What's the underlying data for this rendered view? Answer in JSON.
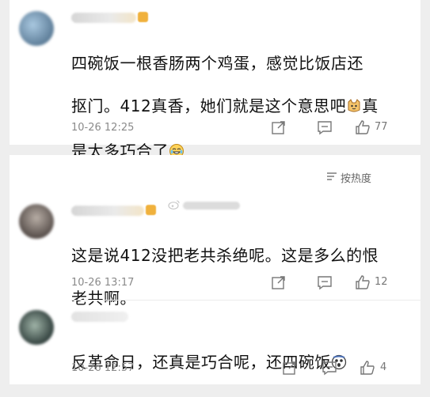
{
  "comments": [
    {
      "text_lines": [
        "四碗饭一根香肠两个鸡蛋，感觉比饭店还",
        "抠门。412真香，她们就是这个意思吧",
        "是太多巧合了"
      ],
      "text_line2_suffix": "真",
      "time": "10-26 12:25",
      "likes": "77"
    },
    {
      "text_lines": [
        "这是说412没把老共杀绝呢。这是多么的恨",
        "老共啊。"
      ],
      "time": "10-26 13:17",
      "likes": "12"
    },
    {
      "text_lines": [
        "反革命日，还真是巧合呢，还四碗饭"
      ],
      "time": "10-26 12:57",
      "likes": "4"
    }
  ],
  "sort_label": "按热度",
  "icons": {
    "share": "share-icon",
    "comment": "comment-icon",
    "like": "thumbs-up-icon",
    "sort": "sort-icon",
    "weibo": "weibo-logo-icon"
  },
  "colors": {
    "background": "#eeeeee",
    "card": "#ffffff",
    "text": "#111111",
    "meta": "#8a8a8a"
  }
}
